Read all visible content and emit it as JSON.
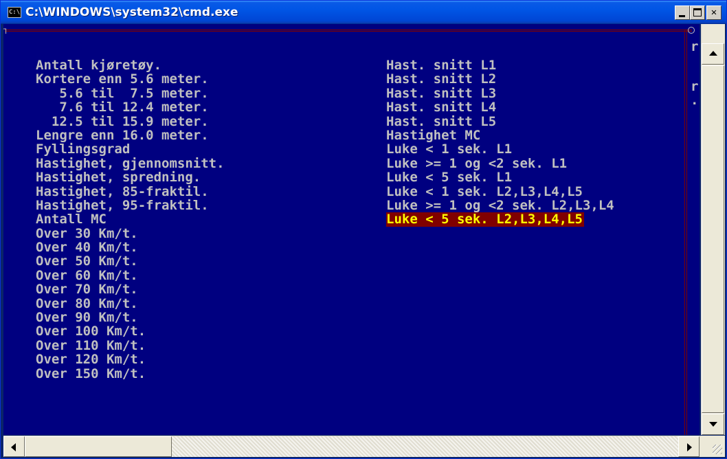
{
  "window": {
    "title": "C:\\WINDOWS\\system32\\cmd.exe",
    "icon_label": "C:\\"
  },
  "titlebar_buttons": {
    "minimize": "minimize",
    "maximize": "maximize",
    "close": "✕"
  },
  "console": {
    "corner_char": "┐",
    "edge_right": [
      "r",
      "r",
      "."
    ],
    "left_column": [
      "Antall kjøretøy.",
      "Kortere enn 5.6 meter.",
      "   5.6 til  7.5 meter.",
      "   7.6 til 12.4 meter.",
      "  12.5 til 15.9 meter.",
      "Lengre enn 16.0 meter.",
      "Fyllingsgrad",
      "Hastighet, gjennomsnitt.",
      "Hastighet, spredning.",
      "Hastighet, 85-fraktil.",
      "Hastighet, 95-fraktil.",
      "Antall MC",
      "Over 30 Km/t.",
      "Over 40 Km/t.",
      "Over 50 Km/t.",
      "Over 60 Km/t.",
      "Over 70 Km/t.",
      "Over 80 Km/t.",
      "Over 90 Km/t.",
      "Over 100 Km/t.",
      "Over 110 Km/t.",
      "Over 120 Km/t.",
      "Over 150 Km/t."
    ],
    "right_column": [
      "Hast. snitt L1",
      "Hast. snitt L2",
      "Hast. snitt L3",
      "Hast. snitt L4",
      "Hast. snitt L5",
      "Hastighet MC",
      "Luke < 1 sek. L1",
      "Luke >= 1 og <2 sek. L1",
      "Luke < 5 sek. L1",
      "Luke < 1 sek. L2,L3,L4,L5",
      "Luke >= 1 og <2 sek. L2,L3,L4",
      "Luke < 5 sek. L2,L3,L4,L5"
    ],
    "selected_index": 11
  },
  "colors": {
    "console_bg": "#000080",
    "console_fg": "#c0c0c0",
    "highlight_bg": "#800000",
    "highlight_fg": "#ffff00"
  }
}
